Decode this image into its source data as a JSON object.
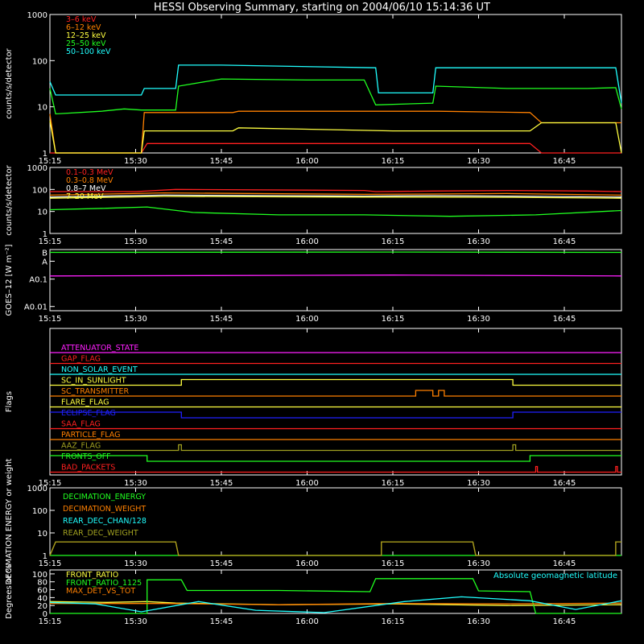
{
  "title": "HESSI Observing Summary, starting on 2004/06/10 15:14:36 UT",
  "time_axis": {
    "start": "15:15",
    "end": "16:55",
    "ticks": [
      "15:15",
      "15:30",
      "15:45",
      "16:00",
      "16:15",
      "16:30",
      "16:45"
    ],
    "tick_minutes": [
      0,
      15,
      30,
      45,
      60,
      75,
      90
    ]
  },
  "chart_data": [
    {
      "type": "line",
      "ylabel": "counts/s/detector",
      "scale": "log",
      "ylim": [
        1,
        1000
      ],
      "yticks": [
        "1",
        "10",
        "100",
        "1000"
      ],
      "legend": "top-left",
      "series": [
        {
          "name": "3–6 keV",
          "color": "#ff2020",
          "pts": [
            [
              0,
              1
            ],
            [
              16,
              1
            ],
            [
              17,
              1.6
            ],
            [
              33,
              1.6
            ],
            [
              40,
              1.6
            ],
            [
              60,
              1.6
            ],
            [
              68,
              1.6
            ],
            [
              84,
              1.6
            ],
            [
              86,
              1
            ],
            [
              100,
              1
            ]
          ]
        },
        {
          "name": "6–12 keV",
          "color": "#ff8000",
          "pts": [
            [
              0,
              7
            ],
            [
              1,
              1
            ],
            [
              16,
              1
            ],
            [
              16.5,
              7.5
            ],
            [
              32,
              7.5
            ],
            [
              33,
              8
            ],
            [
              53,
              8
            ],
            [
              68,
              8
            ],
            [
              84,
              7.5
            ],
            [
              86,
              4.5
            ],
            [
              100,
              4.5
            ]
          ]
        },
        {
          "name": "12–25 keV",
          "color": "#ffff40",
          "pts": [
            [
              0,
              5
            ],
            [
              1,
              1
            ],
            [
              16,
              1
            ],
            [
              16.5,
              3
            ],
            [
              32,
              3
            ],
            [
              33,
              3.5
            ],
            [
              60,
              3
            ],
            [
              84,
              3
            ],
            [
              86,
              4.5
            ],
            [
              99,
              4.5
            ],
            [
              100,
              1
            ]
          ]
        },
        {
          "name": "25–50 keV",
          "color": "#20ff20",
          "pts": [
            [
              0,
              25
            ],
            [
              1,
              7
            ],
            [
              9,
              8
            ],
            [
              13,
              9
            ],
            [
              16,
              8.5
            ],
            [
              22,
              8.5
            ],
            [
              22.5,
              28
            ],
            [
              30,
              40
            ],
            [
              45,
              38
            ],
            [
              55,
              38
            ],
            [
              57,
              11
            ],
            [
              67,
              12
            ],
            [
              67.5,
              28
            ],
            [
              80,
              25
            ],
            [
              94,
              25
            ],
            [
              99,
              26
            ],
            [
              100,
              9
            ]
          ]
        },
        {
          "name": "50–100 keV",
          "color": "#20ffff",
          "pts": [
            [
              0,
              35
            ],
            [
              1,
              18
            ],
            [
              16,
              18
            ],
            [
              16.5,
              25
            ],
            [
              22,
              25
            ],
            [
              22.5,
              80
            ],
            [
              30,
              80
            ],
            [
              57,
              70
            ],
            [
              57.5,
              20
            ],
            [
              67,
              20
            ],
            [
              67.5,
              70
            ],
            [
              80,
              70
            ],
            [
              99,
              70
            ],
            [
              100,
              12
            ]
          ]
        }
      ]
    },
    {
      "type": "line",
      "ylabel": "counts/s/detector",
      "scale": "log",
      "ylim": [
        1,
        1000
      ],
      "yticks": [
        "1",
        "10",
        "100",
        "1000"
      ],
      "legend": "top-left",
      "series": [
        {
          "name": "0.1–0.3 MeV",
          "color": "#ff2020",
          "pts": [
            [
              0,
              80
            ],
            [
              15,
              80
            ],
            [
              22,
              100
            ],
            [
              55,
              90
            ],
            [
              57,
              80
            ],
            [
              67,
              85
            ],
            [
              80,
              90
            ],
            [
              94,
              85
            ],
            [
              100,
              80
            ]
          ]
        },
        {
          "name": "0.3–0.8 MeV",
          "color": "#ff8000",
          "pts": [
            [
              0,
              55
            ],
            [
              20,
              70
            ],
            [
              55,
              60
            ],
            [
              67,
              62
            ],
            [
              80,
              65
            ],
            [
              100,
              55
            ]
          ]
        },
        {
          "name": "0.8–7 MeV",
          "color": "#ffffff",
          "pts": [
            [
              0,
              45
            ],
            [
              20,
              55
            ],
            [
              55,
              50
            ],
            [
              67,
              52
            ],
            [
              80,
              50
            ],
            [
              100,
              45
            ]
          ]
        },
        {
          "name": "7–20 MeV",
          "color": "#ffff40",
          "pts": [
            [
              0,
              40
            ],
            [
              20,
              48
            ],
            [
              55,
              45
            ],
            [
              67,
              45
            ],
            [
              80,
              44
            ],
            [
              100,
              40
            ]
          ]
        },
        {
          "name": "",
          "color": "#20ff20",
          "pts": [
            [
              0,
              12
            ],
            [
              10,
              14
            ],
            [
              17,
              16
            ],
            [
              25,
              9
            ],
            [
              40,
              7
            ],
            [
              55,
              7
            ],
            [
              70,
              6
            ],
            [
              85,
              7
            ],
            [
              100,
              11
            ]
          ]
        }
      ]
    },
    {
      "type": "line",
      "ylabel": "GOES–12 [W m⁻²]",
      "scale": "log",
      "yticks": [
        "A0.01",
        "A0.1",
        "A",
        "B"
      ],
      "series": [
        {
          "name": "",
          "color": "#20ff20",
          "pts": [
            [
              0,
              0.95
            ],
            [
              60,
              0.97
            ],
            [
              100,
              0.95
            ]
          ]
        },
        {
          "name": "",
          "color": "#ff20ff",
          "pts": [
            [
              0,
              0.13
            ],
            [
              60,
              0.14
            ],
            [
              100,
              0.13
            ]
          ]
        }
      ]
    },
    {
      "type": "line",
      "ylabel": "Flags",
      "legend": "left",
      "series": [
        {
          "name": "ATTENUATOR_STATE",
          "color": "#ff20ff",
          "pts": [
            [
              0,
              0
            ],
            [
              100,
              0
            ]
          ]
        },
        {
          "name": "GAP_FLAG",
          "color": "#ff2020",
          "pts": [
            [
              0,
              0
            ],
            [
              100,
              0
            ]
          ]
        },
        {
          "name": "NON_SOLAR_EVENT",
          "color": "#20ffff",
          "pts": [
            [
              0,
              0
            ],
            [
              100,
              0
            ]
          ]
        },
        {
          "name": "SC_IN_SUNLIGHT",
          "color": "#ffff40",
          "pts": [
            [
              0,
              0
            ],
            [
              23,
              0
            ],
            [
              23,
              1
            ],
            [
              81,
              1
            ],
            [
              81,
              0
            ],
            [
              100,
              0
            ]
          ]
        },
        {
          "name": "SC_TRANSMITTER",
          "color": "#ff8000",
          "pts": [
            [
              0,
              0
            ],
            [
              64,
              0
            ],
            [
              64,
              1
            ],
            [
              67,
              1
            ],
            [
              67,
              0
            ],
            [
              68,
              0
            ],
            [
              68,
              1
            ],
            [
              69,
              1
            ],
            [
              69,
              0
            ],
            [
              100,
              0
            ]
          ]
        },
        {
          "name": "FLARE_FLAG",
          "color": "#ffff40",
          "pts": [
            [
              0,
              0
            ],
            [
              100,
              0
            ]
          ]
        },
        {
          "name": "ECLIPSE_FLAG",
          "color": "#2020ff",
          "pts": [
            [
              0,
              1
            ],
            [
              23,
              1
            ],
            [
              23,
              0
            ],
            [
              81,
              0
            ],
            [
              81,
              1
            ],
            [
              100,
              1
            ]
          ]
        },
        {
          "name": "SAA_FLAG",
          "color": "#ff2020",
          "pts": [
            [
              0,
              0
            ],
            [
              100,
              0
            ]
          ]
        },
        {
          "name": "PARTICLE_FLAG",
          "color": "#ff8000",
          "pts": [
            [
              0,
              0
            ],
            [
              100,
              0
            ]
          ]
        },
        {
          "name": "AAZ_FLAG",
          "color": "#a0a020",
          "pts": [
            [
              0,
              0
            ],
            [
              22.5,
              0
            ],
            [
              22.5,
              1
            ],
            [
              23,
              1
            ],
            [
              23,
              0
            ],
            [
              81,
              0
            ],
            [
              81,
              1
            ],
            [
              81.5,
              1
            ],
            [
              81.5,
              0
            ],
            [
              100,
              0
            ]
          ]
        },
        {
          "name": "FRONTS_OFF",
          "color": "#20ff20",
          "pts": [
            [
              0,
              1
            ],
            [
              17,
              1
            ],
            [
              17,
              0
            ],
            [
              84,
              0
            ],
            [
              84,
              1
            ],
            [
              100,
              1
            ]
          ]
        },
        {
          "name": "BAD_PACKETS",
          "color": "#ff2020",
          "pts": [
            [
              0,
              0
            ],
            [
              85,
              0
            ],
            [
              85,
              1
            ],
            [
              85.3,
              1
            ],
            [
              85.3,
              0
            ],
            [
              99,
              0
            ],
            [
              99,
              1
            ],
            [
              99.3,
              1
            ],
            [
              99.3,
              0
            ],
            [
              100,
              0
            ]
          ]
        }
      ]
    },
    {
      "type": "line",
      "ylabel": "DECIMATION ENERGY or weight",
      "scale": "log",
      "ylim": [
        1,
        1000
      ],
      "yticks": [
        "1",
        "10",
        "100",
        "1000"
      ],
      "legend": "top-left",
      "series": [
        {
          "name": "DECIMATION_ENERGY",
          "color": "#20ff20",
          "pts": [
            [
              0,
              1
            ],
            [
              100,
              1
            ]
          ]
        },
        {
          "name": "DECIMATION_WEIGHT",
          "color": "#ff8000",
          "pts": [
            [
              0,
              1
            ],
            [
              1,
              4
            ],
            [
              22,
              4
            ],
            [
              22.5,
              1
            ],
            [
              58,
              1
            ],
            [
              58,
              4
            ],
            [
              74,
              4
            ],
            [
              74.5,
              1
            ],
            [
              99,
              1
            ],
            [
              99,
              4
            ],
            [
              100,
              4
            ]
          ]
        },
        {
          "name": "REAR_DEC_CHAN/128",
          "color": "#20ffff",
          "pts": []
        },
        {
          "name": "REAR_DEC_WEIGHT",
          "color": "#a0a020",
          "pts": [
            [
              0,
              1
            ],
            [
              1,
              4
            ],
            [
              22,
              4
            ],
            [
              22.5,
              1
            ],
            [
              58,
              1
            ],
            [
              58,
              4
            ],
            [
              74,
              4
            ],
            [
              74.5,
              1
            ],
            [
              99,
              1
            ],
            [
              99,
              4
            ],
            [
              100,
              4
            ]
          ]
        }
      ]
    },
    {
      "type": "line",
      "ylabel": "Degrees or %",
      "scale": "linear",
      "ylim": [
        0,
        110
      ],
      "yticks": [
        "0",
        "20",
        "40",
        "60",
        "80",
        "100"
      ],
      "legend": "top-left",
      "annotation": "Absolute geomagnetic latitude",
      "series": [
        {
          "name": "FRONT_RATIO",
          "color": "#ffff40",
          "pts": [
            [
              0,
              30
            ],
            [
              10,
              28
            ],
            [
              17,
              30
            ],
            [
              22,
              26
            ],
            [
              40,
              22
            ],
            [
              60,
              24
            ],
            [
              80,
              20
            ],
            [
              100,
              22
            ]
          ]
        },
        {
          "name": "FRONT_RATIO_1125",
          "color": "#20ff20",
          "pts": [
            [
              0,
              0
            ],
            [
              17,
              0
            ],
            [
              17,
              85
            ],
            [
              23,
              85
            ],
            [
              24,
              58
            ],
            [
              40,
              58
            ],
            [
              56,
              55
            ],
            [
              57,
              88
            ],
            [
              74,
              88
            ],
            [
              75,
              57
            ],
            [
              84,
              55
            ],
            [
              85,
              0
            ],
            [
              100,
              0
            ]
          ]
        },
        {
          "name": "MAX_DET_VS_TOT",
          "color": "#ff8000",
          "pts": [
            [
              0,
              25
            ],
            [
              20,
              25
            ],
            [
              40,
              22
            ],
            [
              60,
              25
            ],
            [
              80,
              24
            ],
            [
              100,
              26
            ]
          ]
        },
        {
          "name": "",
          "color": "#20ffff",
          "pts": [
            [
              0,
              28
            ],
            [
              8,
              24
            ],
            [
              16,
              4
            ],
            [
              26,
              30
            ],
            [
              36,
              8
            ],
            [
              48,
              2
            ],
            [
              62,
              30
            ],
            [
              72,
              42
            ],
            [
              84,
              32
            ],
            [
              92,
              10
            ],
            [
              100,
              32
            ]
          ]
        }
      ]
    }
  ]
}
